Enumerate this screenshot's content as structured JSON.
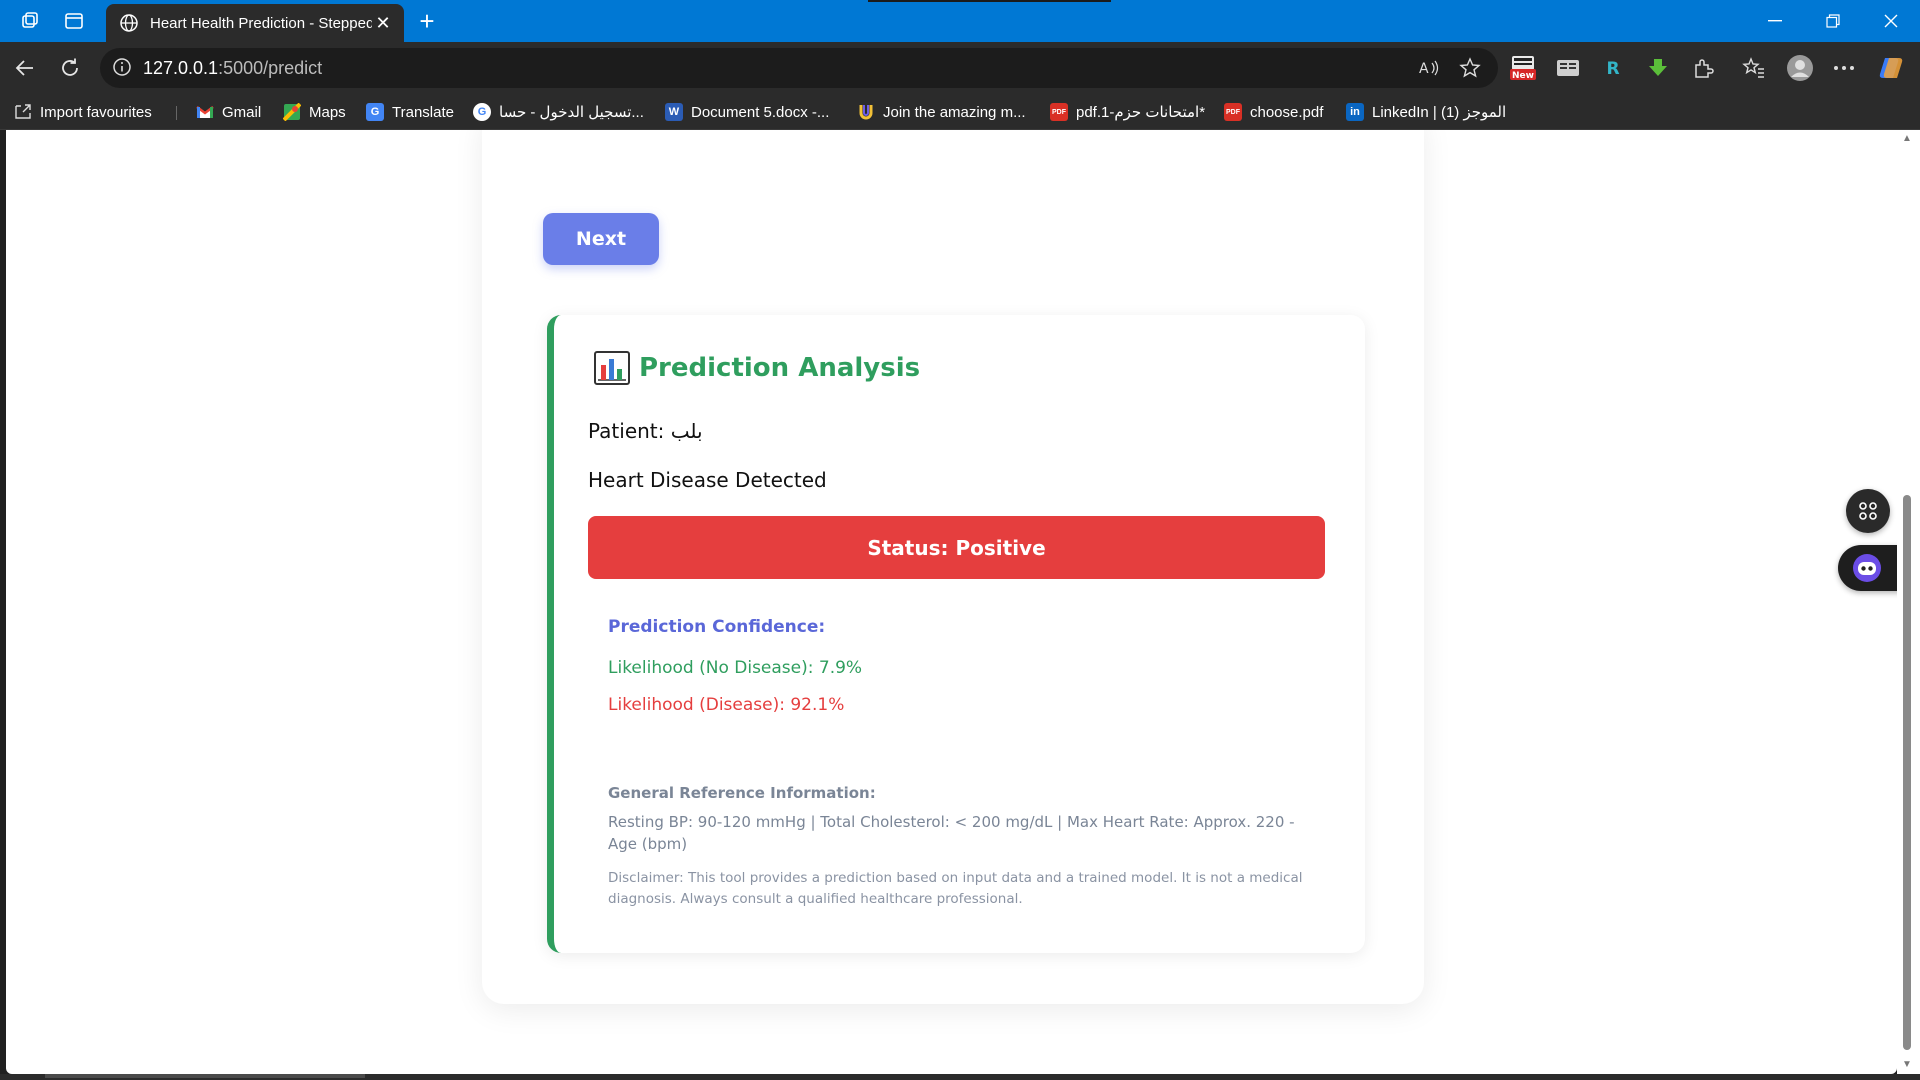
{
  "browser": {
    "tab_title": "Heart Health Prediction - Stepped",
    "url_host": "127.0.0.1",
    "url_path": ":5000/predict",
    "ext_badge": "New"
  },
  "bookmarks": {
    "import": "Import favourites",
    "items": [
      {
        "label": "Gmail",
        "icon": "gmail-icon"
      },
      {
        "label": "Maps",
        "icon": "maps-icon"
      },
      {
        "label": "Translate",
        "icon": "translate-icon"
      },
      {
        "label": "تسجيل الدخول - حسا...",
        "icon": "google-icon"
      },
      {
        "label": "Document 5.docx -...",
        "icon": "word-icon"
      },
      {
        "label": "Join the amazing m...",
        "icon": "app-icon"
      },
      {
        "label": "pdf.1-امتحانات حزم*",
        "icon": "pdf-icon"
      },
      {
        "label": "choose.pdf",
        "icon": "pdf-icon"
      },
      {
        "label": "LinkedIn | الموجز (1)",
        "icon": "linkedin-icon"
      }
    ]
  },
  "form": {
    "next_label": "Next"
  },
  "result": {
    "title": "Prediction Analysis",
    "patient": "Patient: بلب",
    "detection": "Heart Disease Detected",
    "status": "Status: Positive",
    "confidence_title": "Prediction Confidence:",
    "likelihood_no": "Likelihood (No Disease): 7.9%",
    "likelihood_yes": "Likelihood (Disease): 92.1%",
    "reference_title": "General Reference Information:",
    "reference_text": "Resting BP: 90-120 mmHg | Total Cholesterol: < 200 mg/dL | Max Heart Rate: Approx. 220 - Age (bpm)",
    "disclaimer": "Disclaimer: This tool provides a prediction based on input data and a trained model. It is not a medical diagnosis. Always consult a qualified healthcare professional."
  },
  "colors": {
    "accent_green": "#2f9e5e",
    "status_red": "#e53e3e",
    "button_blue": "#6a7ee8",
    "browser_blue": "#0078d4"
  }
}
